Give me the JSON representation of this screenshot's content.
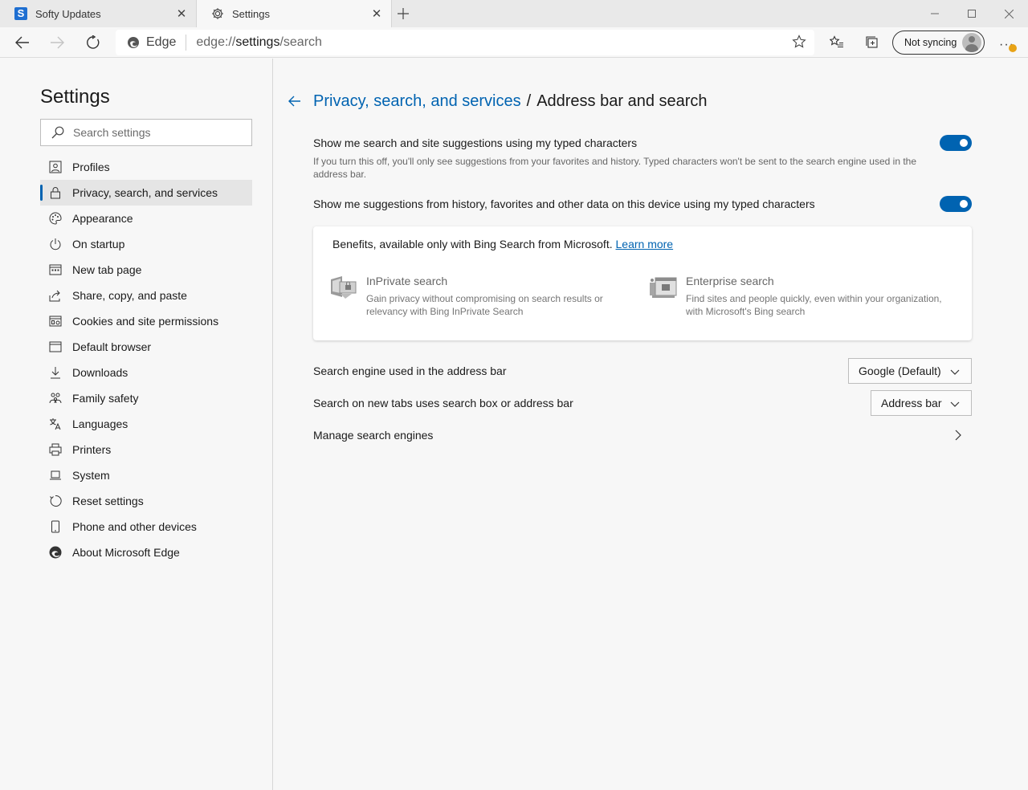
{
  "tabs": [
    {
      "title": "Softy Updates",
      "icon": "softy-s-icon"
    },
    {
      "title": "Settings",
      "icon": "gear-icon"
    }
  ],
  "toolbar": {
    "address_prefix": "Edge",
    "url_scheme": "edge://",
    "url_host": "settings",
    "url_path": "/search",
    "sync_label": "Not syncing"
  },
  "sidebar": {
    "title": "Settings",
    "search_placeholder": "Search settings",
    "items": [
      {
        "label": "Profiles",
        "icon": "profile-card-icon"
      },
      {
        "label": "Privacy, search, and services",
        "icon": "lock-icon",
        "active": true
      },
      {
        "label": "Appearance",
        "icon": "palette-icon"
      },
      {
        "label": "On startup",
        "icon": "power-icon"
      },
      {
        "label": "New tab page",
        "icon": "grid-page-icon"
      },
      {
        "label": "Share, copy, and paste",
        "icon": "share-icon"
      },
      {
        "label": "Cookies and site permissions",
        "icon": "cookies-icon"
      },
      {
        "label": "Default browser",
        "icon": "browser-icon"
      },
      {
        "label": "Downloads",
        "icon": "download-icon"
      },
      {
        "label": "Family safety",
        "icon": "family-icon"
      },
      {
        "label": "Languages",
        "icon": "languages-icon"
      },
      {
        "label": "Printers",
        "icon": "printer-icon"
      },
      {
        "label": "System",
        "icon": "laptop-icon"
      },
      {
        "label": "Reset settings",
        "icon": "reset-icon"
      },
      {
        "label": "Phone and other devices",
        "icon": "phone-icon"
      },
      {
        "label": "About Microsoft Edge",
        "icon": "edge-logo-icon"
      }
    ]
  },
  "main": {
    "breadcrumb_parent": "Privacy, search, and services",
    "breadcrumb_sep": "/",
    "breadcrumb_current": "Address bar and search",
    "setting1": {
      "title": "Show me search and site suggestions using my typed characters",
      "description": "If you turn this off, you'll only see suggestions from your favorites and history. Typed characters won't be sent to the search engine used in the address bar.",
      "enabled": true
    },
    "setting2": {
      "title": "Show me suggestions from history, favorites and other data on this device using my typed characters",
      "enabled": true
    },
    "bing_card": {
      "heading": "Benefits, available only with Bing Search from Microsoft.",
      "learn_more": "Learn more",
      "features": [
        {
          "title": "InPrivate search",
          "description": "Gain privacy without compromising on search results or relevancy with Bing InPrivate Search"
        },
        {
          "title": "Enterprise search",
          "description": "Find sites and people quickly, even within your organization, with Microsoft's Bing search"
        }
      ]
    },
    "search_engine": {
      "label": "Search engine used in the address bar",
      "value": "Google (Default)"
    },
    "new_tab_search": {
      "label": "Search on new tabs uses search box or address bar",
      "value": "Address bar"
    },
    "manage_engines": {
      "label": "Manage search engines"
    }
  },
  "colors": {
    "accent": "#0063b1",
    "background": "#f7f7f7"
  }
}
